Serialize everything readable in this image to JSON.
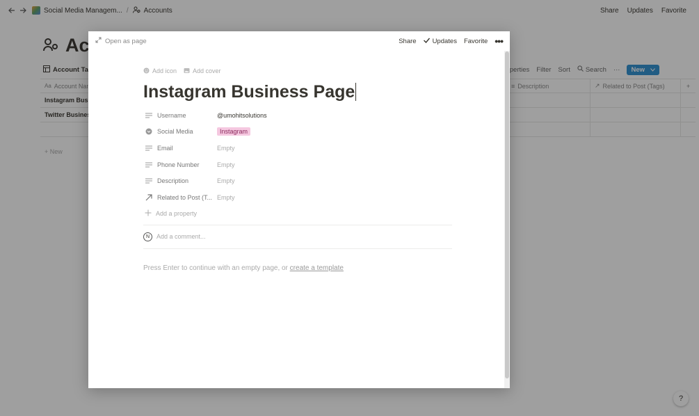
{
  "topbar": {
    "breadcrumb_db": "Social Media Managem...",
    "breadcrumb_page": "Accounts",
    "share": "Share",
    "updates": "Updates",
    "favorite": "Favorite"
  },
  "background": {
    "page_title": "Acc",
    "view_tab": "Account Tabl",
    "properties": "Properties",
    "filter": "Filter",
    "sort": "Sort",
    "search": "Search",
    "more": "···",
    "new_button": "New",
    "columns": {
      "name": "Account Nam",
      "description": "Description",
      "related": "Related to Post (Tags)",
      "add": "+"
    },
    "rows": [
      {
        "name": "Instagram Busin"
      },
      {
        "name": "Twitter Business"
      }
    ],
    "new_row": "+ New",
    "help": "?"
  },
  "modal": {
    "open_as_page": "Open as page",
    "share": "Share",
    "updates": "Updates",
    "favorite": "Favorite",
    "more": "•••",
    "add_icon": "Add icon",
    "add_cover": "Add cover",
    "title": "Instagram Business Page",
    "properties": [
      {
        "icon": "text-icon",
        "label": "Username",
        "value": "@umohitsolutions",
        "empty": false
      },
      {
        "icon": "select-icon",
        "label": "Social Media",
        "value": "Instagram",
        "tag": true,
        "tag_color": "#f5c8e0"
      },
      {
        "icon": "text-icon",
        "label": "Email",
        "value": "Empty",
        "empty": true
      },
      {
        "icon": "text-icon",
        "label": "Phone Number",
        "value": "Empty",
        "empty": true
      },
      {
        "icon": "text-icon",
        "label": "Description",
        "value": "Empty",
        "empty": true
      },
      {
        "icon": "relation-icon",
        "label": "Related to Post (T...",
        "value": "Empty",
        "empty": true
      }
    ],
    "add_property": "Add a property",
    "comment_avatar": "N",
    "comment_placeholder": "Add a comment...",
    "hint_prefix": "Press Enter to continue with an empty page, or ",
    "hint_link": "create a template"
  },
  "colors": {
    "accent": "#2e8fd0",
    "tag_bg": "#f5c8e0",
    "text": "#37352f"
  }
}
